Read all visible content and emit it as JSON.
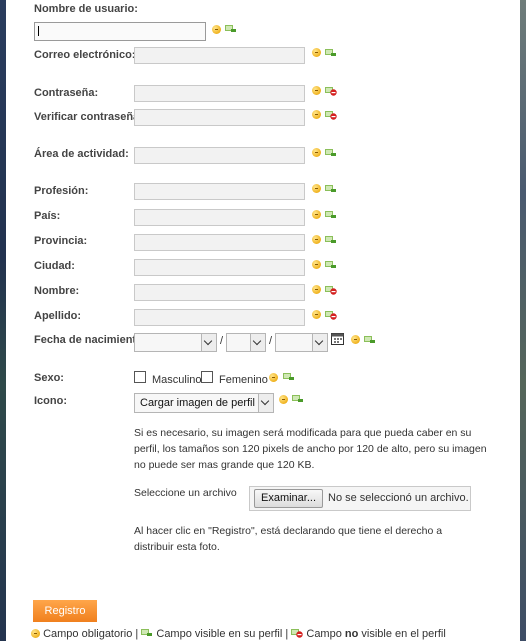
{
  "form": {
    "username_label": "Nombre de usuario:",
    "email_label": "Correo electrónico:",
    "password_label": "Contraseña:",
    "password_confirm_label": "Verificar contraseña:",
    "activity_label": "Área de actividad:",
    "profession_label": "Profesión:",
    "country_label": "País:",
    "province_label": "Provincia:",
    "city_label": "Ciudad:",
    "name_label": "Nombre:",
    "surname_label": "Apellido:",
    "birthdate_label": "Fecha de nacimiento:",
    "birthdate_separator": "/",
    "sex_label": "Sexo:",
    "sex_male": "Masculino",
    "sex_female": "Femenino",
    "icon_label": "Icono:",
    "icon_select_value": "Cargar imagen de perfil",
    "icon_info": "Si es necesario, su imagen será modificada para que pueda caber en su perfil, los tamaños son 120 pixels de ancho por 120 de alto, pero su imagen no puede ser mas grande que 120 KB.",
    "file_select_label": "Seleccione un archivo",
    "file_browse_button": "Examinar...",
    "file_status": "No se seleccionó un archivo.",
    "rights_notice": "Al hacer clic en \"Registro\", está declarando que tiene el derecho a distribuir esta foto.",
    "submit_label": "Registro"
  },
  "legend": {
    "required": "Campo obligatorio |",
    "visible": "Campo visible en su perfil |",
    "not_visible_prefix": "Campo",
    "not_visible_bold": "no",
    "not_visible_suffix": "visible en el perfil"
  },
  "icons": {
    "hint": "help-bulb-icon",
    "visible": "visible-in-profile-icon",
    "not_visible": "not-visible-in-profile-icon",
    "calendar": "calendar-icon"
  },
  "colors": {
    "submit": "#f0801e",
    "visible_green": "#4a9a2a",
    "not_visible_red": "#d42020"
  }
}
